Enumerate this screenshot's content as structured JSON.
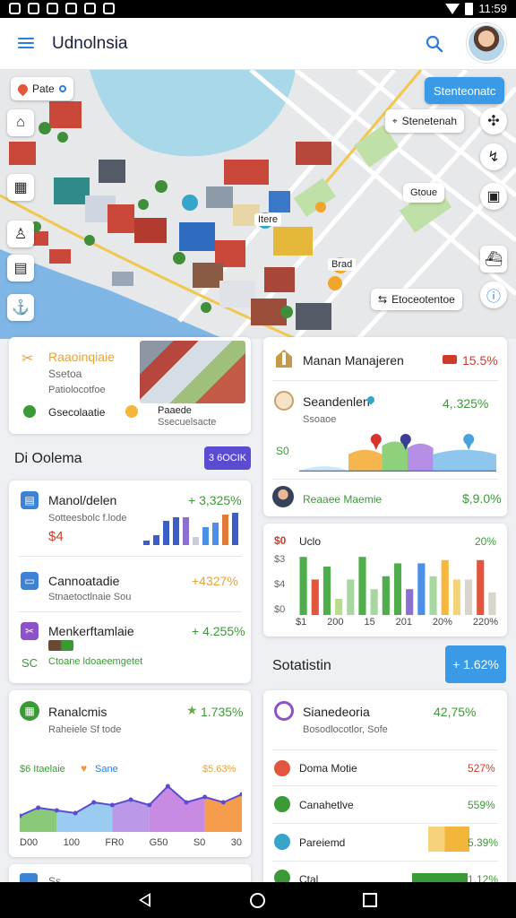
{
  "status_bar": {
    "time": "11:59"
  },
  "app_bar": {
    "title": "Udnolnsia"
  },
  "map": {
    "search_chip": "Pate",
    "cta_button": "Stenteonatc",
    "chip_top_right": "Stenetenah",
    "chip_right": "Gtoue",
    "chip_bottom_right": "Etoceotentoe",
    "marker_labels": [
      "Itere",
      "Brad"
    ]
  },
  "overlay_card": {
    "title": "Raaoinqiaie",
    "line1": "Ssetoa",
    "line2": "Patiolocotfoe",
    "footer": "Gsecolaatie",
    "thumb_title": "Paaede",
    "thumb_sub": "Ssecuelsacte"
  },
  "left_panel": {
    "heading": "Di Oolema",
    "button": "3 6OCIK",
    "rows": [
      {
        "name": "Manol/delen",
        "sub": "Sotteesbolc f.lode",
        "value": "$4",
        "change": "+ 3,325%"
      },
      {
        "name": "Cannoatadie",
        "sub": "Stnaetoctlnaie Sou",
        "change": "+4327%"
      },
      {
        "name": "Menkerftamlaie",
        "sub": "Ctoane ldoaeemgetet",
        "value": "SC",
        "change": "+ 4.255%"
      }
    ],
    "row1_bars": [
      {
        "value": 0.15,
        "color": "#3b5fc6"
      },
      {
        "value": 0.3,
        "color": "#3b5fc6"
      },
      {
        "value": 0.75,
        "color": "#3b5fc6"
      },
      {
        "value": 0.85,
        "color": "#3b5fc6"
      },
      {
        "value": 0.85,
        "color": "#8b6fd1"
      },
      {
        "value": 0.25,
        "color": "#c9cdd6"
      },
      {
        "value": 0.55,
        "color": "#4c8fe8"
      },
      {
        "value": 0.7,
        "color": "#4c8fe8"
      },
      {
        "value": 0.95,
        "color": "#e07b3a"
      },
      {
        "value": 1.0,
        "color": "#3b5fc6"
      }
    ]
  },
  "card_manager": {
    "title": "Manan Manajeren",
    "title_change": "15.5%",
    "row_name": "Seandenlen",
    "row_sub": "Ssoaoe",
    "row_change": "4,.325%",
    "axis_label": "S0",
    "footer_name": "Reaaee Maemie",
    "footer_value": "$,9.0%",
    "area_bands": [
      {
        "from": 0.0,
        "to": 0.25,
        "top": 0.15,
        "color": "#cfe6f7"
      },
      {
        "from": 0.25,
        "to": 0.42,
        "top": 0.55,
        "color": "#f4b64d"
      },
      {
        "from": 0.42,
        "to": 0.55,
        "top": 0.75,
        "color": "#8fd07a"
      },
      {
        "from": 0.55,
        "to": 0.68,
        "top": 0.7,
        "color": "#b58ee6"
      },
      {
        "from": 0.68,
        "to": 1.0,
        "top": 0.55,
        "color": "#8ec6ee"
      }
    ],
    "pins": [
      {
        "pos": 0.39,
        "color": "#d9342b"
      },
      {
        "pos": 0.54,
        "color": "#3b3b98"
      },
      {
        "pos": 0.86,
        "color": "#4aa3df"
      }
    ]
  },
  "card_bars": {
    "title": "Uclo",
    "icon_text": "$0",
    "pct": "20%",
    "yaxis": [
      "$3",
      "$4",
      "$0"
    ],
    "xaxis": [
      "$1",
      "200",
      "15",
      "201",
      "20%",
      "220%"
    ],
    "bars": [
      {
        "value": 0.9,
        "color": "#4fae4b"
      },
      {
        "value": 0.55,
        "color": "#e2563d"
      },
      {
        "value": 0.75,
        "color": "#4fae4b"
      },
      {
        "value": 0.25,
        "color": "#b9dd8c"
      },
      {
        "value": 0.55,
        "color": "#a6d8a0"
      },
      {
        "value": 0.9,
        "color": "#4fae4b"
      },
      {
        "value": 0.4,
        "color": "#a6d8a0"
      },
      {
        "value": 0.6,
        "color": "#4fae4b"
      },
      {
        "value": 0.8,
        "color": "#4fae4b"
      },
      {
        "value": 0.4,
        "color": "#8b6fd1"
      },
      {
        "value": 0.8,
        "color": "#4c8fe8"
      },
      {
        "value": 0.6,
        "color": "#a6d8a0"
      },
      {
        "value": 0.85,
        "color": "#f6b73c"
      },
      {
        "value": 0.55,
        "color": "#f6d27a"
      },
      {
        "value": 0.55,
        "color": "#d9d5cc"
      },
      {
        "value": 0.85,
        "color": "#e2563d"
      },
      {
        "value": 0.35,
        "color": "#d9d5cc"
      }
    ]
  },
  "statistics": {
    "heading": "Sotatistin",
    "button": "+ 1.62%"
  },
  "card_area": {
    "title": "Ranalcmis",
    "sub": "Raheiele Sf tode",
    "change": "1.735%",
    "legend_a": "$6 Itaelaie",
    "legend_b": "Sane",
    "legend_value": "$5.63%",
    "xaxis": [
      "D00",
      "100",
      "FR0",
      "G50",
      "S0",
      "30"
    ],
    "points": [
      0.3,
      0.45,
      0.4,
      0.35,
      0.55,
      0.5,
      0.6,
      0.5,
      0.85,
      0.55,
      0.65,
      0.55,
      0.7
    ],
    "segments": [
      "#7cc36a",
      "#8ec6ee",
      "#b58ee6",
      "#c37de0",
      "#f4913a"
    ]
  },
  "card_list": {
    "title": "Sianedeoria",
    "sub": "Bosodlocotlor, Sofe",
    "change": "42,75%",
    "rows": [
      {
        "name": "Doma Motie",
        "value": "527%"
      },
      {
        "name": "Canahetlve",
        "value": "559%"
      },
      {
        "name": "Pareiemd",
        "value": "5.39%"
      },
      {
        "name": "Ctal",
        "value": "1.12%"
      }
    ]
  },
  "bottom_partial": {
    "label": "Ss"
  }
}
